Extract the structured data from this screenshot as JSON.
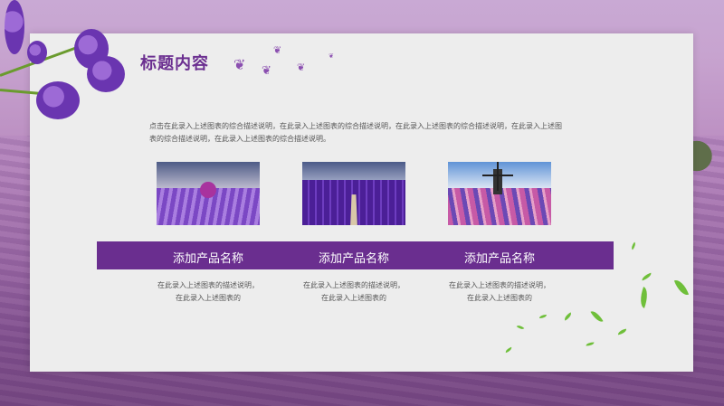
{
  "title": "标题内容",
  "description": "点击在此录入上述图表的综合描述说明，在此录入上述图表的综合描述说明，在此录入上述图表的综合描述说明，在此录入上述图表的综合描述说明，在此录入上述图表的综合描述说明。",
  "products": [
    {
      "name": "添加产品名称",
      "text": "在此录入上述图表的描述说明，在此录入上述图表的"
    },
    {
      "name": "添加产品名称",
      "text": "在此录入上述图表的描述说明，在此录入上述图表的"
    },
    {
      "name": "添加产品名称",
      "text": "在此录入上述图表的描述说明，在此录入上述图表的"
    }
  ],
  "colors": {
    "accent": "#6a2e8f",
    "title": "#6b2f90",
    "panel": "#ededed"
  },
  "icons": [
    "butterfly-icon",
    "leaf-icon",
    "lavender-icon"
  ]
}
